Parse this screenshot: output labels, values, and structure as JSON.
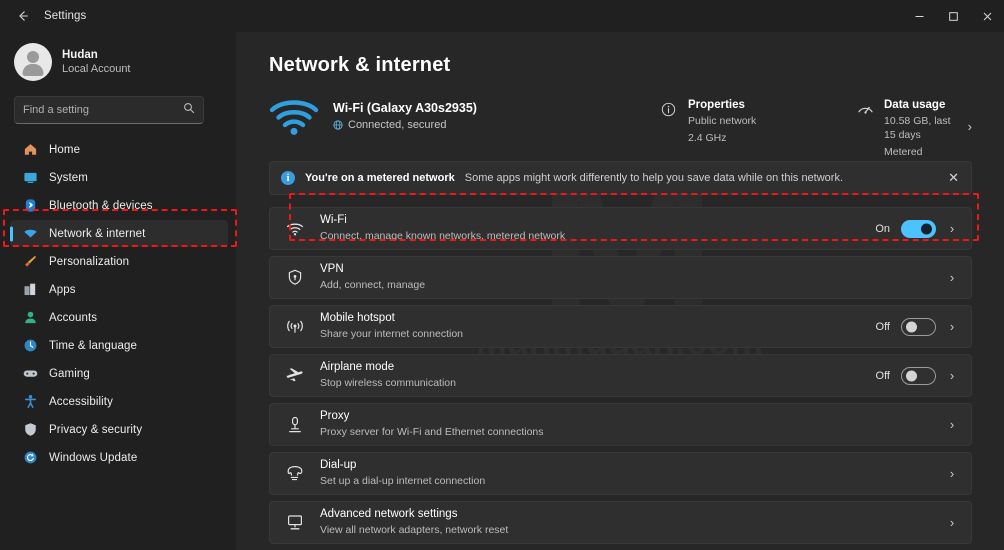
{
  "window": {
    "titlebar_title": "Settings",
    "back_icon": "back-arrow-icon",
    "minimize_label": "–",
    "maximize_label": "□",
    "close_label": "✕"
  },
  "colors": {
    "accent": "#4cc2ff",
    "highlight_box": "#f01717",
    "sidebar_bg": "#202020",
    "main_bg": "#272727",
    "row_bg": "#2f2f2f"
  },
  "watermark": {
    "mark": "M",
    "text": "Mahmudan.com"
  },
  "sidebar": {
    "account": {
      "name": "Hudan",
      "type": "Local Account",
      "avatar_icon": "user-avatar-icon"
    },
    "search": {
      "placeholder": "Find a setting",
      "value": "",
      "icon": "search-icon"
    },
    "items": [
      {
        "label": "Home",
        "icon": "home-icon",
        "selected": false
      },
      {
        "label": "System",
        "icon": "system-icon",
        "selected": false
      },
      {
        "label": "Bluetooth & devices",
        "icon": "bluetooth-icon",
        "selected": false
      },
      {
        "label": "Network & internet",
        "icon": "network-icon",
        "selected": true
      },
      {
        "label": "Personalization",
        "icon": "brush-icon",
        "selected": false
      },
      {
        "label": "Apps",
        "icon": "apps-icon",
        "selected": false
      },
      {
        "label": "Accounts",
        "icon": "accounts-icon",
        "selected": false
      },
      {
        "label": "Time & language",
        "icon": "clock-icon",
        "selected": false
      },
      {
        "label": "Gaming",
        "icon": "gamepad-icon",
        "selected": false
      },
      {
        "label": "Accessibility",
        "icon": "accessibility-icon",
        "selected": false
      },
      {
        "label": "Privacy & security",
        "icon": "shield-icon",
        "selected": false
      },
      {
        "label": "Windows Update",
        "icon": "update-icon",
        "selected": false
      }
    ]
  },
  "main": {
    "page_title": "Network & internet",
    "status": {
      "icon": "wifi-signal-icon",
      "title": "Wi-Fi (Galaxy A30s2935)",
      "subtitle": "Connected, secured",
      "subtitle_icon": "globe-icon"
    },
    "properties": {
      "icon": "info-icon",
      "title": "Properties",
      "line1": "Public network",
      "line2": "2.4 GHz"
    },
    "data_usage": {
      "icon": "data-usage-icon",
      "title": "Data usage",
      "line1": "10.58 GB, last 15 days",
      "line2": "Metered",
      "chevron": "›"
    },
    "banner": {
      "icon": "info-circle-icon",
      "strong": "You're on a metered network",
      "text": "Some apps might work differently to help you save data while on this network.",
      "close_icon": "close-icon",
      "close_label": "✕"
    },
    "rows": [
      {
        "icon": "wifi-icon",
        "title": "Wi-Fi",
        "subtitle": "Connect, manage known networks, metered network",
        "toggle": "on",
        "toggle_label": "On",
        "chevron": "›",
        "highlighted": true
      },
      {
        "icon": "vpn-shield-icon",
        "title": "VPN",
        "subtitle": "Add, connect, manage",
        "toggle": "none",
        "toggle_label": "",
        "chevron": "›",
        "highlighted": false
      },
      {
        "icon": "hotspot-icon",
        "title": "Mobile hotspot",
        "subtitle": "Share your internet connection",
        "toggle": "off",
        "toggle_label": "Off",
        "chevron": "›",
        "highlighted": false
      },
      {
        "icon": "airplane-icon",
        "title": "Airplane mode",
        "subtitle": "Stop wireless communication",
        "toggle": "off",
        "toggle_label": "Off",
        "chevron": "›",
        "highlighted": false
      },
      {
        "icon": "proxy-icon",
        "title": "Proxy",
        "subtitle": "Proxy server for Wi-Fi and Ethernet connections",
        "toggle": "none",
        "toggle_label": "",
        "chevron": "›",
        "highlighted": false
      },
      {
        "icon": "dialup-icon",
        "title": "Dial-up",
        "subtitle": "Set up a dial-up internet connection",
        "toggle": "none",
        "toggle_label": "",
        "chevron": "›",
        "highlighted": false
      },
      {
        "icon": "advanced-network-icon",
        "title": "Advanced network settings",
        "subtitle": "View all network adapters, network reset",
        "toggle": "none",
        "toggle_label": "",
        "chevron": "›",
        "highlighted": false
      }
    ]
  }
}
